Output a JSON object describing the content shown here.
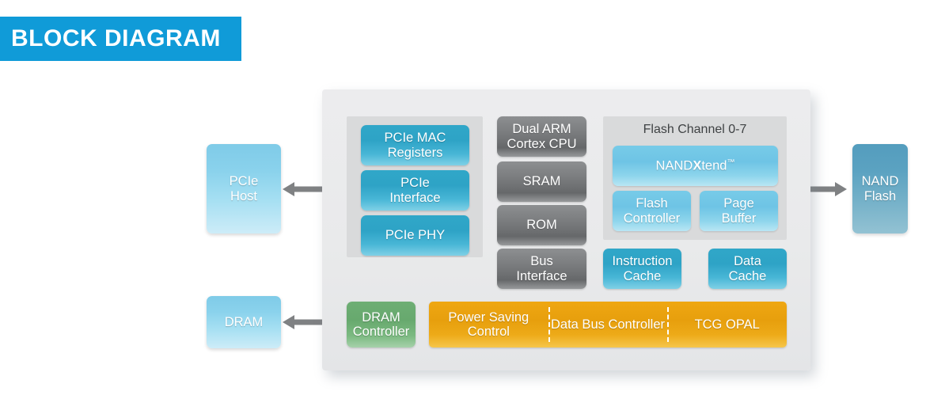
{
  "banner": {
    "title": "BLOCK DIAGRAM",
    "background_color": "#109bd8",
    "text_color": "#ffffff"
  },
  "external_blocks": {
    "pcie_host": {
      "line1": "PCIe",
      "line2": "Host",
      "color": "#8ad2ec"
    },
    "dram": {
      "line1": "DRAM",
      "color": "#8ad2ec"
    },
    "nand_flash": {
      "line1": "NAND",
      "line2": "Flash",
      "color": "#5ba2c1"
    }
  },
  "arrows": {
    "pcie_host_to_chip": "bidirectional",
    "dram_to_chip": "bidirectional",
    "chip_to_nand_flash": "bidirectional",
    "color": "#7f8183"
  },
  "chip": {
    "pcie_panel": {
      "background_color": "#d9dadb",
      "blocks": [
        {
          "line1": "PCIe MAC",
          "line2": "Registers"
        },
        {
          "line1": "PCIe",
          "line2": "Interface"
        },
        {
          "line1": "PCIe PHY",
          "line2": ""
        }
      ]
    },
    "cpu_column": {
      "blocks": [
        {
          "line1": "Dual ARM",
          "line2": "Cortex CPU"
        },
        {
          "line1": "SRAM",
          "line2": ""
        },
        {
          "line1": "ROM",
          "line2": ""
        },
        {
          "line1": "Bus",
          "line2": "Interface"
        }
      ],
      "color": "#787a7c"
    },
    "flash_panel": {
      "title": "Flash Channel 0-7",
      "background_color": "#d9dadb",
      "nandxtend": {
        "prefix": "NAND",
        "bold": "X",
        "suffix": "tend",
        "trademark": "™"
      },
      "blocks": [
        {
          "line1": "Flash",
          "line2": "Controller"
        },
        {
          "line1": "Page",
          "line2": "Buffer"
        }
      ]
    },
    "cache_row": [
      {
        "line1": "Instruction",
        "line2": "Cache"
      },
      {
        "line1": "Data",
        "line2": "Cache"
      }
    ],
    "dram_controller": {
      "line1": "DRAM",
      "line2": "Controller",
      "color": "#67a96e"
    },
    "bottom_bar": {
      "color": "#e79f0d",
      "segments": [
        {
          "line1": "Power Saving",
          "line2": "Control"
        },
        {
          "line1": "Data Bus",
          "line2": "Controller"
        },
        {
          "line1": "TCG",
          "line2": "OPAL"
        }
      ]
    }
  }
}
